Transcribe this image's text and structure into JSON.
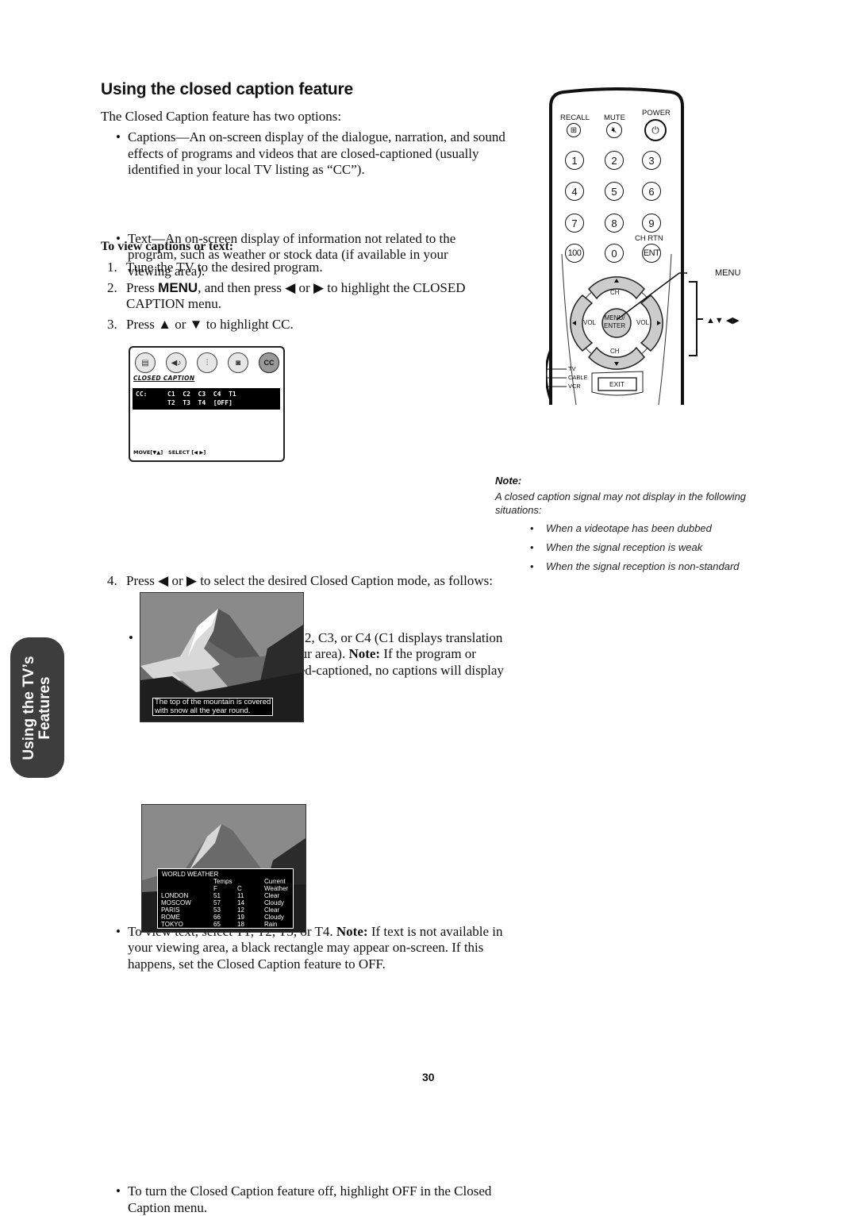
{
  "page": {
    "title": "Using the closed caption feature",
    "intro": "The Closed Caption feature has two options:",
    "options": [
      "Captions—An on-screen display of the dialogue, narration, and sound effects of programs and videos that are closed-captioned (usually identified in your local TV listing as “CC”).",
      "Text—An on-screen display of information not related to the program, such as weather or stock data (if available in your viewing area)."
    ],
    "subheading": "To view captions or text:",
    "steps": [
      {
        "num": "1.",
        "text": "Tune the TV to the desired program."
      },
      {
        "num": "2.",
        "pre": "Press ",
        "key": "MENU",
        "post": ", and then press ◀ or ▶ to highlight the CLOSED CAPTION menu."
      },
      {
        "num": "3.",
        "text": "Press ▲ or ▼ to highlight CC."
      },
      {
        "num": "4.",
        "text": "Press ◀ or ▶ to select the desired Closed Caption mode, as follows:"
      }
    ],
    "sub_bullets": {
      "captions": {
        "pre": "To view captions, select C1, C2, C3, or C4 (C1 displays translation of the primary language in your area). ",
        "note_label": "Note:",
        "post": " If the program or video you selected is not closed-captioned, no captions will display on-screen."
      },
      "text": {
        "pre": "To view text, select T1, T2, T3, or T4. ",
        "note_label": "Note:",
        "post": " If text is not available in your viewing area, a black rectangle may appear on-screen. If this happens, set the Closed Caption feature to OFF."
      },
      "off": "To turn the Closed Caption feature off, highlight OFF in the Closed Caption menu."
    },
    "page_number": "30",
    "side_tab": {
      "line1": "Using the TV’s",
      "line2": "Features"
    }
  },
  "osd_menu": {
    "icons": [
      {
        "name": "picture-icon",
        "glyph": "▤"
      },
      {
        "name": "audio-icon",
        "glyph": "◀♪"
      },
      {
        "name": "setup-icon",
        "glyph": "⫶"
      },
      {
        "name": "video-camera-icon",
        "glyph": "◙"
      },
      {
        "name": "closed-caption-icon",
        "glyph": "CC"
      }
    ],
    "menu_label": "CLOSED CAPTION",
    "row_label": "CC:",
    "options_row1": "C1  C2  C3  C4  T1",
    "options_row2": "T2  T3  T4  [OFF]",
    "selected": "[OFF]",
    "footer": "MOVE[▼▲]   SELECT [◀ ▶]"
  },
  "remote": {
    "top_labels": [
      "RECALL",
      "MUTE",
      "POWER"
    ],
    "number_buttons": [
      "1",
      "2",
      "3",
      "4",
      "5",
      "6",
      "7",
      "8",
      "9",
      "100",
      "0",
      "ENT"
    ],
    "ch_rtn_label": "CH RTN",
    "dpad": {
      "up": "CH",
      "down": "CH",
      "left": "VOL",
      "right": "VOL",
      "center": "MENU/\nENTER"
    },
    "mode_switch": [
      "TV",
      "CABLE",
      "VCR"
    ],
    "exit_label": "EXIT",
    "callouts": {
      "menu": "MENU",
      "arrows": "▲▼ ◀▶"
    }
  },
  "caption_example": {
    "text_line1": "The top of the mountain is covered",
    "text_line2": "with snow all the year round."
  },
  "weather_example": {
    "title": "WORLD WEATHER",
    "headers": [
      "",
      "Temps",
      "",
      "Current"
    ],
    "subheaders": [
      "",
      "F",
      "C",
      "Weather"
    ],
    "rows": [
      [
        "LONDON",
        "51",
        "11",
        "Clear"
      ],
      [
        "MOSCOW",
        "57",
        "14",
        "Cloudy"
      ],
      [
        "PARIS",
        "53",
        "12",
        "Clear"
      ],
      [
        "ROME",
        "66",
        "19",
        "Cloudy"
      ],
      [
        "TOKYO",
        "65",
        "18",
        "Rain"
      ]
    ]
  },
  "note": {
    "title": "Note:",
    "text": "A closed caption signal may not display in the following situations:",
    "items": [
      "When a videotape has been dubbed",
      "When the signal reception is weak",
      "When the signal reception is non-standard"
    ]
  }
}
